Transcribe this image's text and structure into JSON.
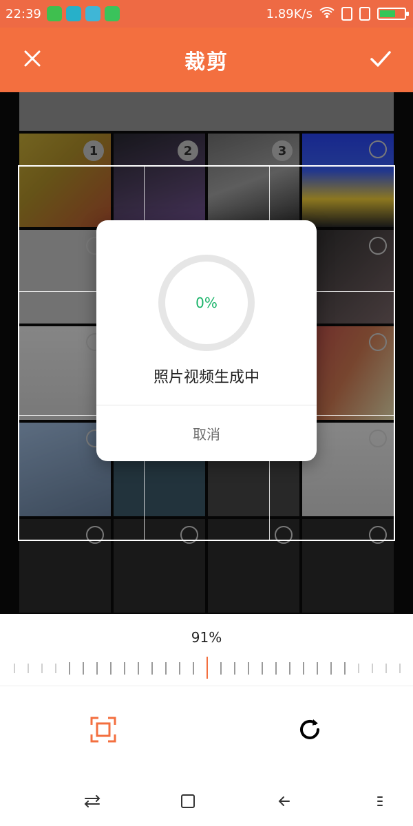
{
  "status_bar": {
    "time": "22:39",
    "network_speed": "1.89K/s",
    "battery_level": 0.65,
    "notif_colors": [
      "#3fbf4f",
      "#27b0c9",
      "#3fb6d6",
      "#3ac35b"
    ]
  },
  "header": {
    "title": "裁剪",
    "close_icon": "close-icon",
    "confirm_icon": "check-icon",
    "brand_color": "#f36f3f"
  },
  "photo_grid": {
    "selected_numbers": [
      "1",
      "2",
      "3"
    ]
  },
  "dialog": {
    "progress_text": "0%",
    "message": "照片视频生成中",
    "cancel_label": "取消",
    "progress_color": "#18b368"
  },
  "scale": {
    "label": "91%",
    "value_percent": 91
  },
  "tools": {
    "crop_icon": "crop-frame-icon",
    "rotate_icon": "rotate-icon"
  },
  "navigation": {
    "items": [
      "switch-icon",
      "home-icon",
      "back-icon",
      "menu-icon"
    ]
  }
}
